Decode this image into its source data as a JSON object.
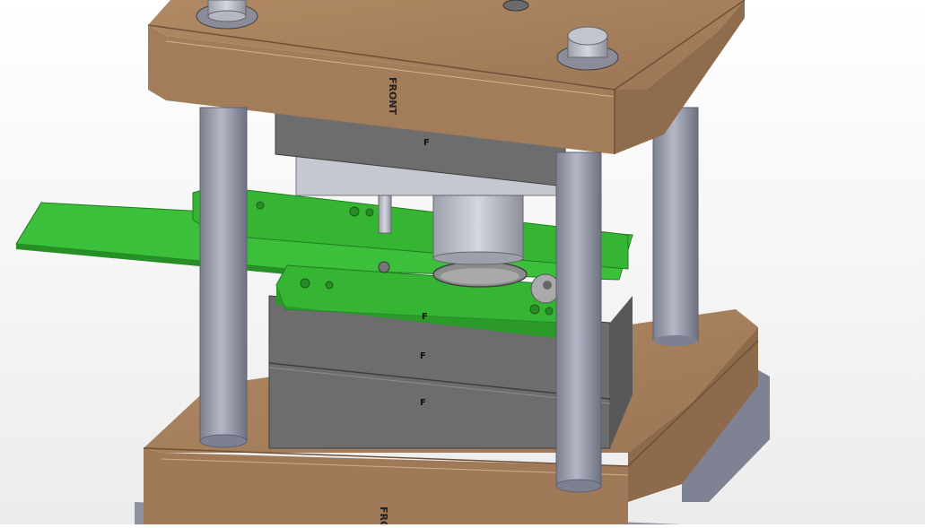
{
  "labels": {
    "top_plate_mark": "FRONT",
    "bottom_plate_mark": "FRONT",
    "punch_plate_mark": "F",
    "stripper_mark": "F",
    "die_block_mark": "F",
    "die_base_mark": "F"
  },
  "colors": {
    "background": "#f4f4f4",
    "plate_wood": "#a37c5a",
    "plate_wood_edge": "#7f5c3e",
    "steel_gray": "#6f6e6e",
    "pillar": "#9a9ead",
    "strip_green": "#31b530",
    "strip_green_dark": "#1f7d1f",
    "cylinder_gray": "#b7b9c4"
  }
}
